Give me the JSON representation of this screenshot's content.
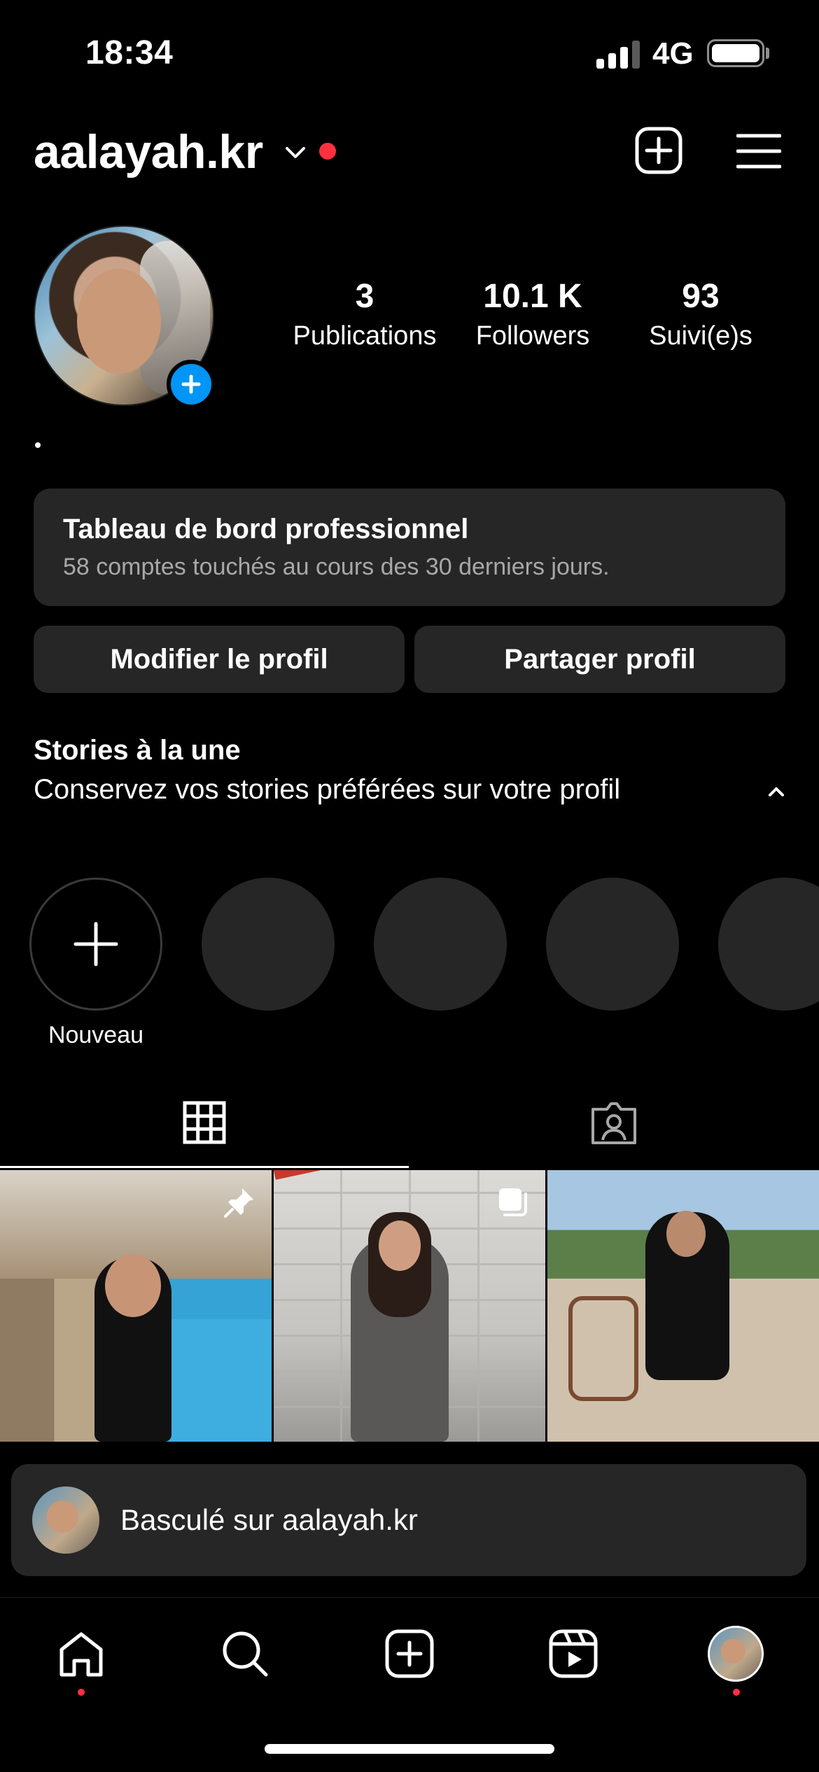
{
  "status_bar": {
    "time": "18:34",
    "network": "4G",
    "signal_bars_filled": 3,
    "signal_bars_total": 4,
    "battery_level": 1.0
  },
  "header": {
    "username": "aalayah.kr",
    "icons": [
      "chevron-down-icon",
      "notification-dot",
      "add-content-icon",
      "menu-icon"
    ]
  },
  "profile": {
    "stats": [
      {
        "value": "3",
        "label": "Publications"
      },
      {
        "value": "10.1 K",
        "label": "Followers"
      },
      {
        "value": "93",
        "label": "Suivi(e)s"
      }
    ],
    "bio": "."
  },
  "dashboard": {
    "title": "Tableau de bord professionnel",
    "subtitle": "58 comptes touchés au cours des 30 derniers jours."
  },
  "buttons": {
    "edit": "Modifier le profil",
    "share": "Partager profil"
  },
  "highlights": {
    "title": "Stories à la une",
    "subtitle": "Conservez vos stories préférées sur votre profil",
    "new_label": "Nouveau"
  },
  "tabs": [
    "grid-icon",
    "tagged-icon"
  ],
  "toast": {
    "text": "Basculé sur aalayah.kr"
  },
  "nav": [
    "home-icon",
    "search-icon",
    "create-icon",
    "reels-icon",
    "profile-avatar"
  ],
  "colors": {
    "background": "#000000",
    "surface": "#262626",
    "accent_blue": "#0095f6",
    "notification_red": "#ff3040"
  }
}
